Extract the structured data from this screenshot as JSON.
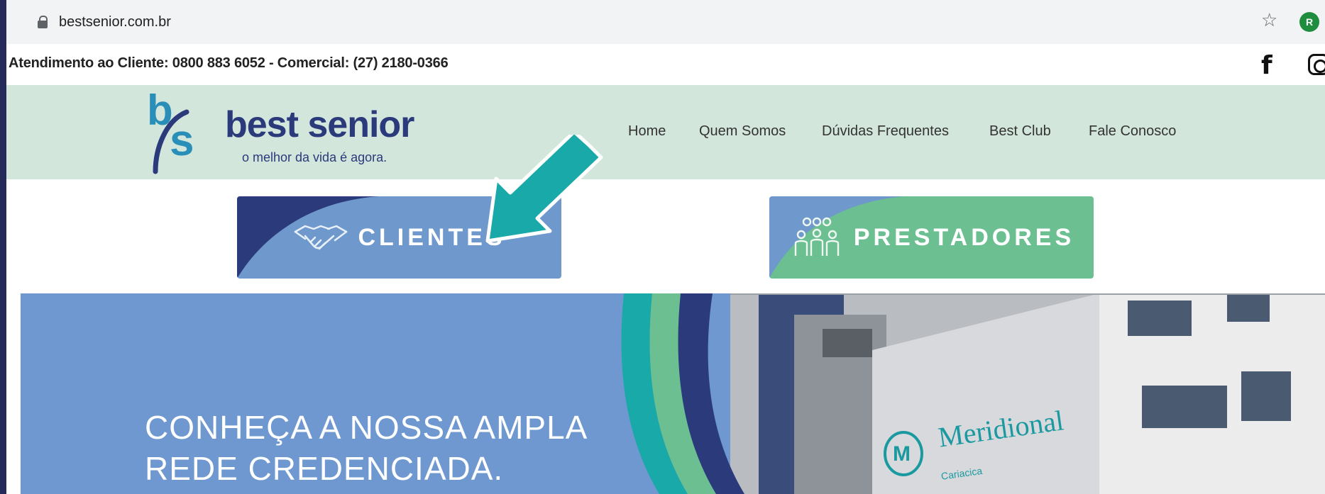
{
  "browser": {
    "url": "bestsenior.com.br",
    "profile_initial": "R"
  },
  "topbar": {
    "contact": "Atendimento ao Cliente: 0800 883 6052 - Comercial: (27) 2180-0366"
  },
  "header": {
    "logo_letter_b": "b",
    "logo_letter_s": "s",
    "logo_name": "best senior",
    "logo_tagline": "o melhor da vida é agora.",
    "nav": [
      "Home",
      "Quem Somos",
      "Dúvidas Frequentes",
      "Best Club",
      "Fale Conosco"
    ]
  },
  "buttons": {
    "clientes": "CLIENTES",
    "prestadores": "PRESTADORES"
  },
  "banner": {
    "line1": "CONHEÇA A NOSSA AMPLA",
    "line2": "REDE CREDENCIADA.",
    "sign_name": "Meridional",
    "sign_sub": "Cariacica",
    "sign_logo": "M"
  },
  "colors": {
    "frame": "#252a5a",
    "header_bg": "#d3e6dc",
    "clientes_bg": "#6f98cd",
    "prestadores_bg": "#6bbf90",
    "arrow": "#1aa9a9",
    "navy": "#2a3a7a",
    "teal": "#2a8fb8"
  },
  "icons": {
    "lock": "lock-icon",
    "star": "star-icon",
    "facebook": "facebook-icon",
    "instagram": "instagram-icon",
    "handshake": "handshake-icon",
    "people": "people-group-icon",
    "arrow": "pointer-arrow-icon"
  }
}
